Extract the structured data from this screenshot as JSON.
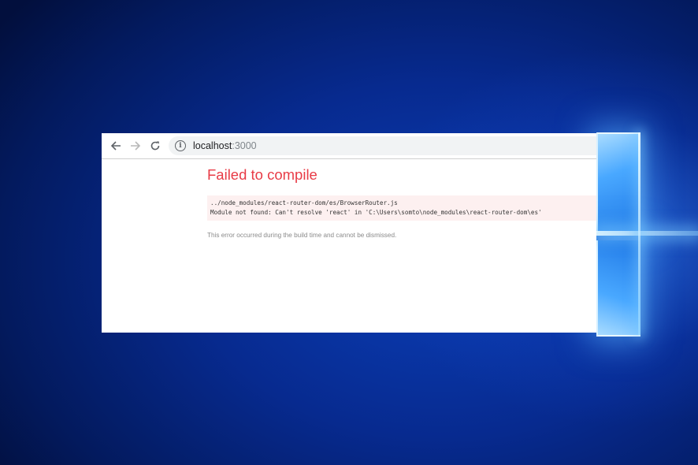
{
  "browser": {
    "url_host": "localhost",
    "url_port": ":3000",
    "back_icon": "arrow-left-icon",
    "forward_icon": "arrow-right-icon",
    "reload_icon": "reload-icon",
    "site_info_icon": "info-icon"
  },
  "overlay": {
    "title": "Failed to compile",
    "error_file": "../node_modules/react-router-dom/es/BrowserRouter.js",
    "error_message": "Module not found: Can't resolve 'react' in 'C:\\Users\\somto\\node_modules\\react-router-dom\\es'",
    "note": "This error occurred during the build time and cannot be dismissed.",
    "title_color": "#e83b46"
  },
  "desktop": {
    "background_color": "#072a8f",
    "logo": "windows-logo"
  }
}
